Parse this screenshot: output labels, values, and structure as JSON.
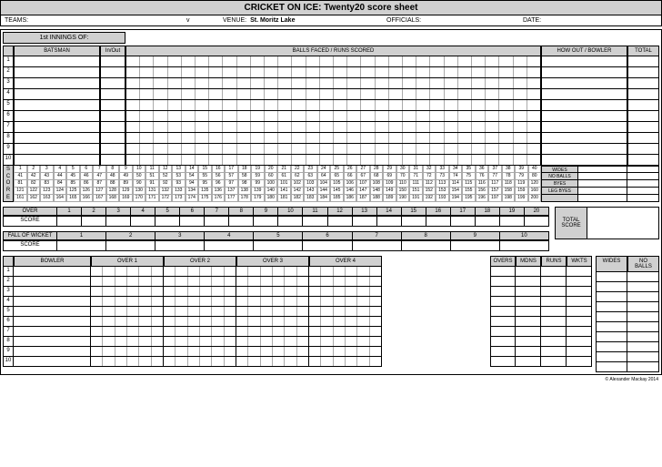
{
  "title": "CRICKET ON ICE: Twenty20 score sheet",
  "meta": {
    "teams_label": "TEAMS:",
    "vs": "v",
    "venue_label": "VENUE:",
    "venue_value": "St. Moritz Lake",
    "officials_label": "OFFICIALS:",
    "date_label": "DATE:"
  },
  "innings_label": "1st INNINGS OF:",
  "headers": {
    "batsman": "BATSMAN",
    "inout": "In/Out",
    "balls": "BALLS FACED / RUNS SCORED",
    "howout": "HOW OUT / BOWLER",
    "total": "TOTAL"
  },
  "score_label": [
    "S",
    "C",
    "O",
    "R",
    "E"
  ],
  "score_numbers": [
    [
      1,
      2,
      3,
      4,
      5,
      6,
      7,
      8,
      9,
      10,
      11,
      12,
      13,
      14,
      15,
      16,
      17,
      18,
      19,
      20,
      21,
      22,
      23,
      24,
      25,
      26,
      27,
      28,
      29,
      30,
      31,
      32,
      33,
      34,
      35,
      36,
      37,
      38,
      39,
      40
    ],
    [
      41,
      42,
      43,
      44,
      45,
      46,
      47,
      48,
      49,
      50,
      51,
      52,
      53,
      54,
      55,
      56,
      57,
      58,
      59,
      60,
      61,
      62,
      63,
      64,
      65,
      66,
      67,
      68,
      69,
      70,
      71,
      72,
      73,
      74,
      75,
      76,
      77,
      78,
      79,
      80
    ],
    [
      81,
      82,
      83,
      84,
      85,
      86,
      87,
      88,
      89,
      90,
      91,
      92,
      93,
      94,
      95,
      96,
      97,
      98,
      99,
      100,
      101,
      102,
      103,
      104,
      105,
      106,
      107,
      108,
      109,
      110,
      111,
      112,
      113,
      114,
      115,
      116,
      117,
      118,
      119,
      120
    ],
    [
      121,
      122,
      123,
      124,
      125,
      126,
      127,
      128,
      129,
      130,
      131,
      132,
      133,
      134,
      135,
      136,
      137,
      138,
      139,
      140,
      141,
      142,
      143,
      144,
      145,
      146,
      147,
      148,
      149,
      150,
      151,
      152,
      153,
      154,
      155,
      156,
      157,
      158,
      159,
      160
    ],
    [
      161,
      162,
      163,
      164,
      165,
      166,
      167,
      168,
      169,
      170,
      171,
      172,
      173,
      174,
      175,
      176,
      177,
      178,
      179,
      180,
      181,
      182,
      183,
      184,
      185,
      186,
      187,
      188,
      189,
      190,
      191,
      192,
      193,
      194,
      195,
      196,
      197,
      198,
      199,
      200
    ]
  ],
  "extras": [
    "WIDES",
    "NO BALLS",
    "BYES",
    "LEG BYES"
  ],
  "over_label": "OVER",
  "score_row_label": "SCORE",
  "overs": [
    1,
    2,
    3,
    4,
    5,
    6,
    7,
    8,
    9,
    10,
    11,
    12,
    13,
    14,
    15,
    16,
    17,
    18,
    19,
    20
  ],
  "fow_label": "FALL OF WICKET",
  "fow_nums": [
    1,
    2,
    3,
    4,
    5,
    6,
    7,
    8,
    9,
    10
  ],
  "total_score_label": "TOTAL SCORE",
  "bowler_label": "BOWLER",
  "bowler_overs": [
    "OVER 1",
    "OVER 2",
    "OVER 3",
    "OVER 4"
  ],
  "stats": [
    "OVERS",
    "MDNS",
    "RUNS",
    "WKTS"
  ],
  "extras2": [
    "WIDES",
    "NO BALLS"
  ],
  "rows": [
    1,
    2,
    3,
    4,
    5,
    6,
    7,
    8,
    9,
    10
  ],
  "credit": "© Alexander Mackay 2014"
}
